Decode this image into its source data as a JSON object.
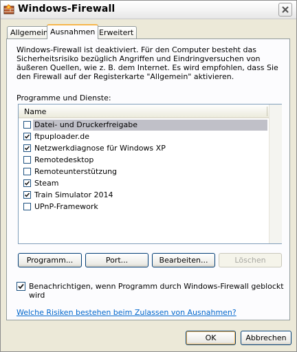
{
  "window": {
    "title": "Windows-Firewall",
    "app_icon": "firewall-icon",
    "close_icon": "close-icon"
  },
  "tabs": [
    {
      "label": "Allgemein",
      "active": false
    },
    {
      "label": "Ausnahmen",
      "active": true
    },
    {
      "label": "Erweitert",
      "active": false
    }
  ],
  "exceptions": {
    "description": "Windows-Firewall ist deaktiviert. Für den Computer besteht das Sicherheitsrisiko bezüglich Angriffen und Eindringversuchen von äußeren Quellen, wie z. B. dem Internet. Es wird empfohlen, dass Sie den Firewall auf der Registerkarte \"Allgemein\" aktivieren.",
    "list_label": "Programme und Dienste:",
    "column_header": "Name",
    "items": [
      {
        "label": "Datei- und Druckerfreigabe",
        "checked": false,
        "selected": true
      },
      {
        "label": "ftpuploader.de",
        "checked": true,
        "selected": false
      },
      {
        "label": "Netzwerkdiagnose für Windows XP",
        "checked": true,
        "selected": false
      },
      {
        "label": "Remotedesktop",
        "checked": false,
        "selected": false
      },
      {
        "label": "Remoteunterstützung",
        "checked": false,
        "selected": false
      },
      {
        "label": "Steam",
        "checked": true,
        "selected": false
      },
      {
        "label": "Train Simulator 2014",
        "checked": true,
        "selected": false
      },
      {
        "label": "UPnP-Framework",
        "checked": false,
        "selected": false
      }
    ],
    "buttons": {
      "program": "Programm...",
      "port": "Port...",
      "edit": "Bearbeiten...",
      "delete": "Löschen"
    },
    "notify": {
      "label": "Benachrichtigen, wenn Programm durch Windows-Firewall geblockt wird",
      "checked": true
    },
    "help_link": "Welche Risiken bestehen beim Zulassen von Ausnahmen?"
  },
  "footer": {
    "ok": "OK",
    "cancel": "Abbrechen"
  },
  "colors": {
    "dialog_bg": "#ECE9D8",
    "panel_bg": "#FCFCFE",
    "link": "#0066CC",
    "selection": "#C0C0C8",
    "active_tab_accent": "#F7B64B"
  }
}
